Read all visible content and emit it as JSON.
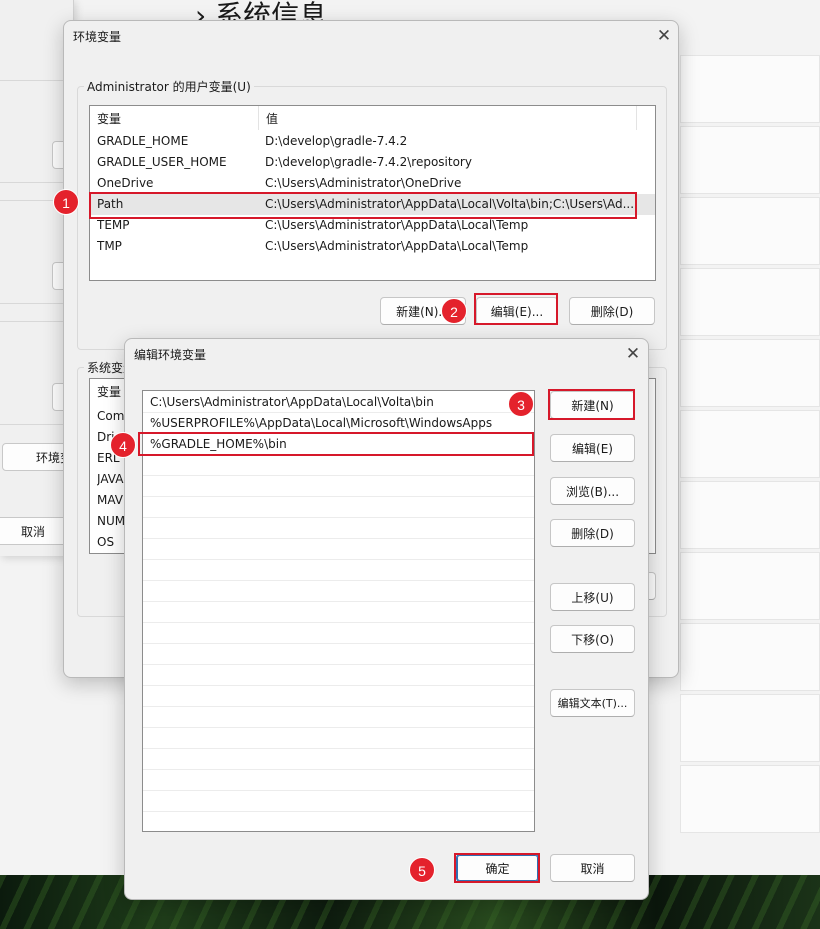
{
  "background": {
    "settings_title": "› 系统信息",
    "sysprop_env_button": "环境变",
    "sysprop_cancel_button": "取消"
  },
  "env_dialog": {
    "title": "环境变量",
    "user_group_label": "Administrator 的用户变量(U)",
    "col_variable": "变量",
    "col_value": "值",
    "rows": [
      {
        "name": "GRADLE_HOME",
        "value": "D:\\develop\\gradle-7.4.2"
      },
      {
        "name": "GRADLE_USER_HOME",
        "value": "D:\\develop\\gradle-7.4.2\\repository"
      },
      {
        "name": "OneDrive",
        "value": "C:\\Users\\Administrator\\OneDrive"
      },
      {
        "name": "Path",
        "value": "C:\\Users\\Administrator\\AppData\\Local\\Volta\\bin;C:\\Users\\Ad..."
      },
      {
        "name": "TEMP",
        "value": "C:\\Users\\Administrator\\AppData\\Local\\Temp"
      },
      {
        "name": "TMP",
        "value": "C:\\Users\\Administrator\\AppData\\Local\\Temp"
      }
    ],
    "new_button": "新建(N)...",
    "edit_button": "编辑(E)...",
    "delete_button": "删除(D)",
    "system_group_label": "系统变量",
    "system_col_variable": "变量",
    "system_rows": [
      "Com",
      "Dri",
      "ERL",
      "JAVA",
      "MAV",
      "NUM",
      "OS"
    ]
  },
  "edit_dialog": {
    "title": "编辑环境变量",
    "paths": [
      "C:\\Users\\Administrator\\AppData\\Local\\Volta\\bin",
      "%USERPROFILE%\\AppData\\Local\\Microsoft\\WindowsApps",
      "%GRADLE_HOME%\\bin"
    ],
    "new_button": "新建(N)",
    "edit_button": "编辑(E)",
    "browse_button": "浏览(B)...",
    "delete_button": "删除(D)",
    "move_up_button": "上移(U)",
    "move_down_button": "下移(O)",
    "edit_text_button": "编辑文本(T)...",
    "ok_button": "确定",
    "cancel_button": "取消"
  },
  "annotations": [
    "1",
    "2",
    "3",
    "4",
    "5"
  ],
  "colors": {
    "annotation_red": "#e4222c",
    "box_red": "#d6182a",
    "default_button_blue": "#2f6fb3"
  }
}
